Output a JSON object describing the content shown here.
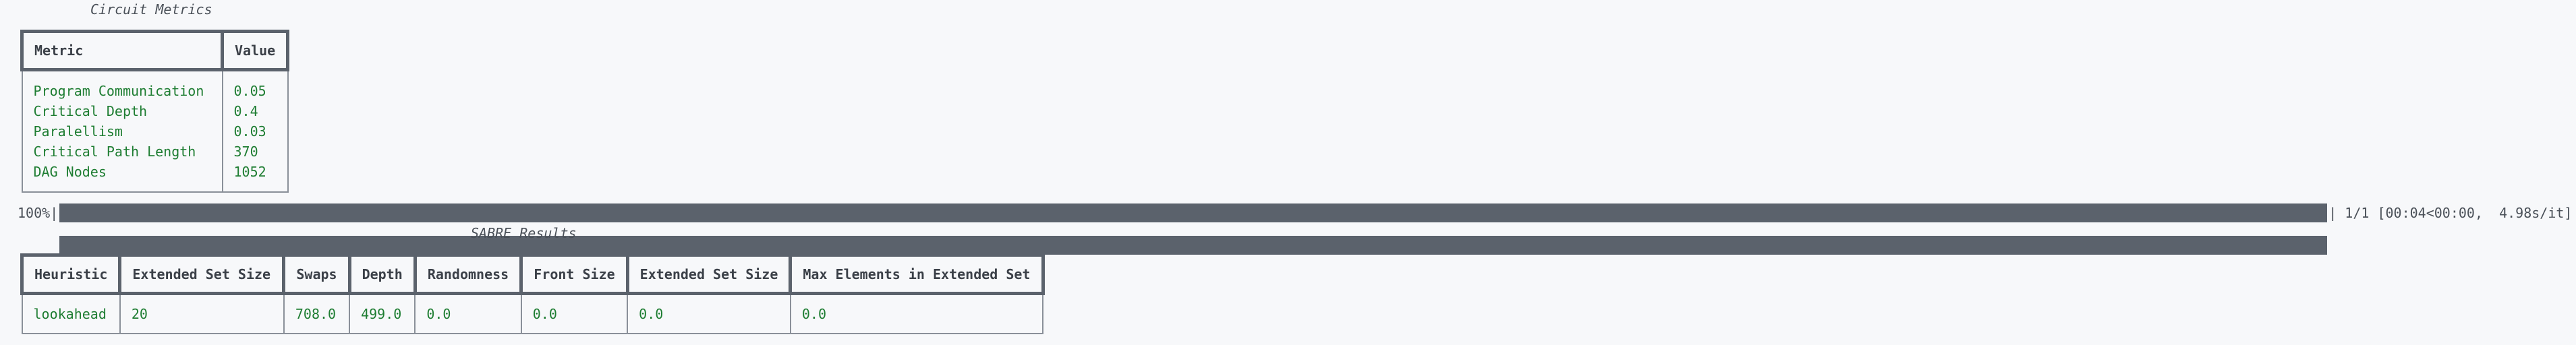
{
  "metrics": {
    "caption": "Circuit Metrics",
    "headers": [
      "Metric",
      "Value"
    ],
    "rows": [
      [
        "Program Communication",
        "0.05"
      ],
      [
        "Critical Depth",
        "0.4"
      ],
      [
        "Paralellism",
        "0.03"
      ],
      [
        "Critical Path Length",
        "370"
      ],
      [
        "DAG Nodes",
        "1052"
      ]
    ]
  },
  "progress": {
    "percent_label": "100%|",
    "fraction": 1.0,
    "stats": "| 1/1 [00:04<00:00,  4.98s/it]"
  },
  "sabre": {
    "caption": "SABRE Results",
    "headers": [
      "Heuristic",
      "Extended Set Size",
      "Swaps",
      "Depth",
      "Randomness",
      "Front Size",
      "Extended Set Size",
      "Max Elements in Extended Set"
    ],
    "rows": [
      [
        "lookahead",
        "20",
        "708.0",
        "499.0",
        "0.0",
        "0.0",
        "0.0",
        "0.0"
      ]
    ]
  }
}
